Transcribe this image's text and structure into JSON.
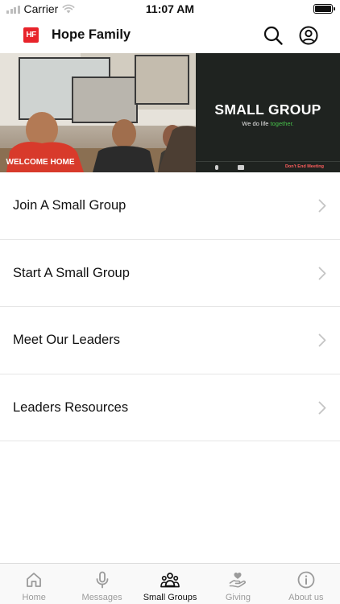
{
  "status_bar": {
    "carrier": "Carrier",
    "time": "11:07 AM"
  },
  "header": {
    "logo_text": "HF",
    "title": "Hope Family",
    "icons": [
      "search-icon",
      "account-icon"
    ]
  },
  "hero": {
    "sign_text": "WELCOME HOME",
    "title": "SMALL GROUP",
    "tagline_prefix": "We do life ",
    "tagline_highlight": "together.",
    "end_meeting": "Don't End Meeting"
  },
  "menu": {
    "items": [
      {
        "label": "Join A Small Group"
      },
      {
        "label": "Start A Small Group"
      },
      {
        "label": "Meet Our Leaders"
      },
      {
        "label": "Leaders Resources"
      }
    ]
  },
  "tabs": [
    {
      "label": "Home",
      "icon": "home-icon",
      "active": false
    },
    {
      "label": "Messages",
      "icon": "microphone-icon",
      "active": false
    },
    {
      "label": "Small Groups",
      "icon": "group-icon",
      "active": true
    },
    {
      "label": "Giving",
      "icon": "giving-hand-heart-icon",
      "active": false
    },
    {
      "label": "About us",
      "icon": "info-icon",
      "active": false
    }
  ],
  "colors": {
    "brand_red": "#e8232a",
    "tagline_green": "#47c04a",
    "tab_inactive": "#9b9b9b",
    "tab_active": "#111111",
    "hero_dark_panel": "#1f2320"
  }
}
